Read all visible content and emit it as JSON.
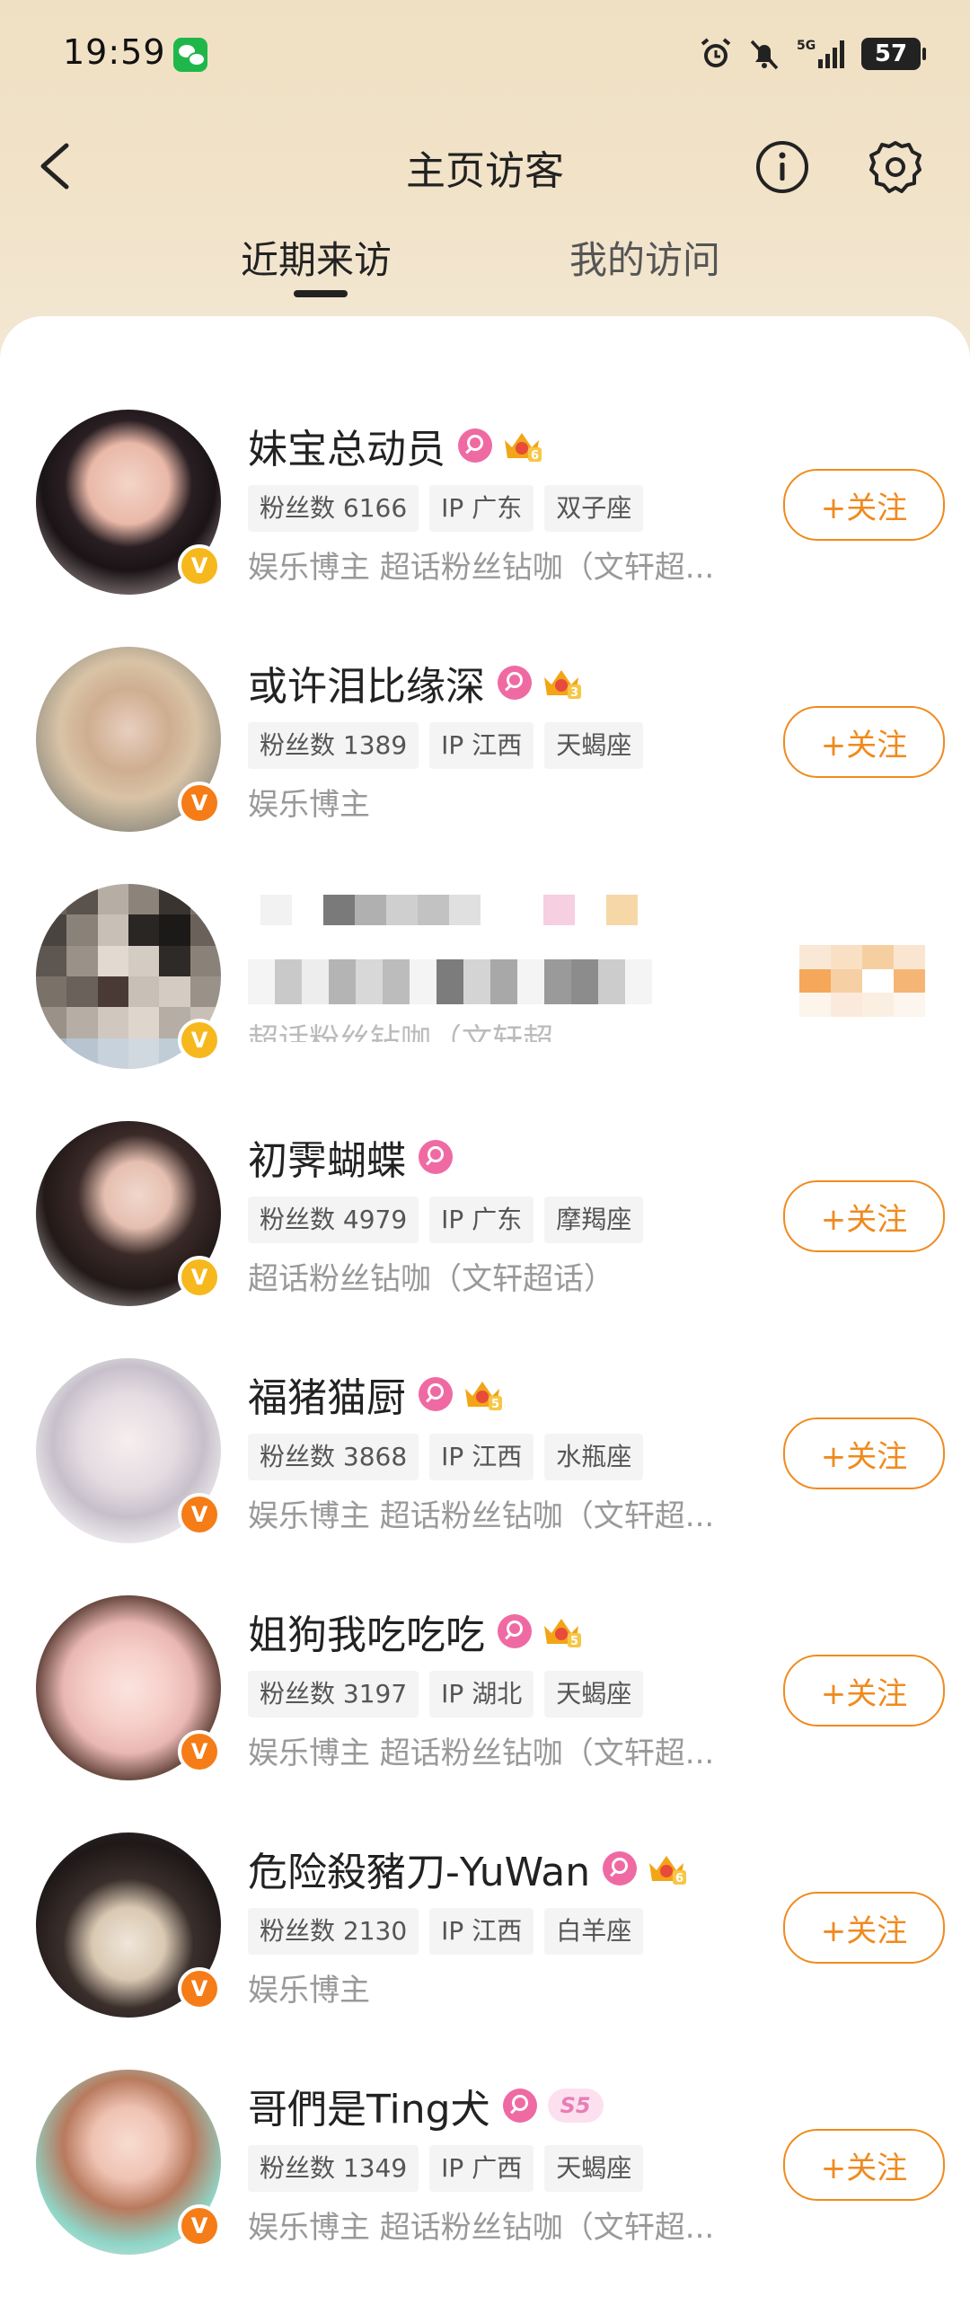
{
  "status_bar": {
    "time": "19:59",
    "battery": "57",
    "icons": [
      "wechat-icon",
      "alarm-icon",
      "bell-off-icon",
      "5g-signal-icon",
      "battery-icon"
    ]
  },
  "header": {
    "title": "主页访客",
    "back_icon": "chevron-left-icon",
    "info_icon": "info-icon",
    "settings_icon": "gear-icon"
  },
  "tabs": [
    {
      "label": "近期来访",
      "active": true
    },
    {
      "label": "我的访问",
      "active": false
    }
  ],
  "follow_label": "+关注",
  "visitors": [
    {
      "name": "妹宝总动员",
      "crown": "6",
      "fans": "粉丝数 6166",
      "ip": "IP 广东",
      "zodiac": "双子座",
      "desc": "娱乐博主 超话粉丝钻咖（文轩超...",
      "verify": "gold"
    },
    {
      "name": "或许泪比缘深",
      "crown": "3",
      "fans": "粉丝数 1389",
      "ip": "IP 江西",
      "zodiac": "天蝎座",
      "desc": "娱乐博主",
      "verify": "orange"
    },
    {
      "name": "",
      "crown": "",
      "fans": "",
      "ip": "",
      "zodiac": "",
      "desc": "超话粉丝钻咖（文轩超",
      "verify": "gold",
      "blurred": true
    },
    {
      "name": "初霁蝴蝶",
      "crown": "",
      "fans": "粉丝数 4979",
      "ip": "IP 广东",
      "zodiac": "摩羯座",
      "desc": "超话粉丝钻咖（文轩超话）",
      "verify": "gold"
    },
    {
      "name": "福猪猫厨",
      "crown": "5",
      "fans": "粉丝数 3868",
      "ip": "IP 江西",
      "zodiac": "水瓶座",
      "desc": "娱乐博主 超话粉丝钻咖（文轩超...",
      "verify": "orange"
    },
    {
      "name": "姐狗我吃吃吃",
      "crown": "5",
      "fans": "粉丝数 3197",
      "ip": "IP 湖北",
      "zodiac": "天蝎座",
      "desc": "娱乐博主 超话粉丝钻咖（文轩超...",
      "verify": "orange"
    },
    {
      "name": "危险殺豬刀-YuWan",
      "crown": "6",
      "fans": "粉丝数 2130",
      "ip": "IP 江西",
      "zodiac": "白羊座",
      "desc": "娱乐博主",
      "verify": "orange"
    },
    {
      "name": "哥們是Ting犬",
      "crown": "",
      "badge": "S5",
      "fans": "粉丝数 1349",
      "ip": "IP 广西",
      "zodiac": "天蝎座",
      "desc": "娱乐博主 超话粉丝钻咖（文轩超...",
      "verify": "orange"
    }
  ],
  "colors": {
    "accent": "#f08a1e",
    "female_badge": "#ef6aa3",
    "verify_gold": "#f6b81d",
    "verify_orange": "#f57c16",
    "header_bg": "#f0e0c3"
  }
}
